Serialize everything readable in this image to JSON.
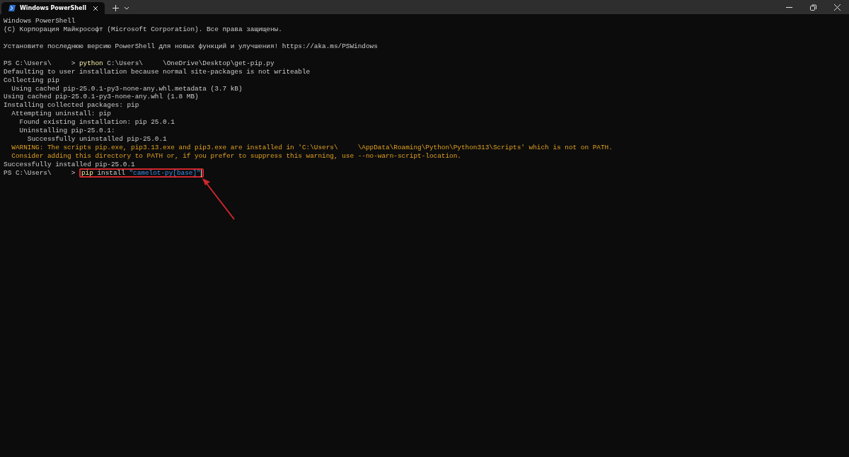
{
  "window": {
    "tab": {
      "title": "Windows PowerShell",
      "selected": true
    }
  },
  "terminal": {
    "lines": [
      {
        "kind": "text",
        "segments": [
          {
            "kind": "plain",
            "text": "Windows PowerShell"
          }
        ]
      },
      {
        "kind": "text",
        "segments": [
          {
            "kind": "plain",
            "text": "(C) Корпорация Майкрософт (Microsoft Corporation). Все права защищены."
          }
        ]
      },
      {
        "kind": "blank"
      },
      {
        "kind": "text",
        "segments": [
          {
            "kind": "plain",
            "text": "Установите последнюю версию PowerShell для новых функций и улучшения! https://aka.ms/PSWindows"
          }
        ]
      },
      {
        "kind": "blank"
      },
      {
        "kind": "text",
        "segments": [
          {
            "kind": "plain",
            "text": "PS C:\\Users\\     > "
          },
          {
            "kind": "command",
            "text": "python"
          },
          {
            "kind": "plain",
            "text": " C:\\Users\\     \\OneDrive\\Desktop\\get-pip.py"
          }
        ]
      },
      {
        "kind": "text",
        "segments": [
          {
            "kind": "plain",
            "text": "Defaulting to user installation because normal site-packages is not writeable"
          }
        ]
      },
      {
        "kind": "text",
        "segments": [
          {
            "kind": "plain",
            "text": "Collecting pip"
          }
        ]
      },
      {
        "kind": "text",
        "segments": [
          {
            "kind": "plain",
            "text": "  Using cached pip-25.0.1-py3-none-any.whl.metadata (3.7 kB)"
          }
        ]
      },
      {
        "kind": "text",
        "segments": [
          {
            "kind": "plain",
            "text": "Using cached pip-25.0.1-py3-none-any.whl (1.8 MB)"
          }
        ]
      },
      {
        "kind": "text",
        "segments": [
          {
            "kind": "plain",
            "text": "Installing collected packages: pip"
          }
        ]
      },
      {
        "kind": "text",
        "segments": [
          {
            "kind": "plain",
            "text": "  Attempting uninstall: pip"
          }
        ]
      },
      {
        "kind": "text",
        "segments": [
          {
            "kind": "plain",
            "text": "    Found existing installation: pip 25.0.1"
          }
        ]
      },
      {
        "kind": "text",
        "segments": [
          {
            "kind": "plain",
            "text": "    Uninstalling pip-25.0.1:"
          }
        ]
      },
      {
        "kind": "text",
        "segments": [
          {
            "kind": "plain",
            "text": "      Successfully uninstalled pip-25.0.1"
          }
        ]
      },
      {
        "kind": "text",
        "segments": [
          {
            "kind": "warning",
            "text": "  WARNING: The scripts pip.exe, pip3.13.exe and pip3.exe are installed in 'C:\\Users\\     \\AppData\\Roaming\\Python\\Python313\\Scripts' which is not on PATH."
          }
        ]
      },
      {
        "kind": "text",
        "segments": [
          {
            "kind": "warning",
            "text": "  Consider adding this directory to PATH or, if you prefer to suppress this warning, use --no-warn-script-location."
          }
        ]
      },
      {
        "kind": "text",
        "segments": [
          {
            "kind": "plain",
            "text": "Successfully installed pip-25.0.1"
          }
        ]
      },
      {
        "kind": "text",
        "segments": [
          {
            "kind": "plain",
            "text": "PS C:\\Users\\     > "
          }
        ],
        "marked_segments": [
          {
            "kind": "command",
            "text": "pip"
          },
          {
            "kind": "plain",
            "text": " install "
          },
          {
            "kind": "string",
            "text": "\"camelot-py[base]\""
          }
        ],
        "cursor": true
      }
    ]
  }
}
